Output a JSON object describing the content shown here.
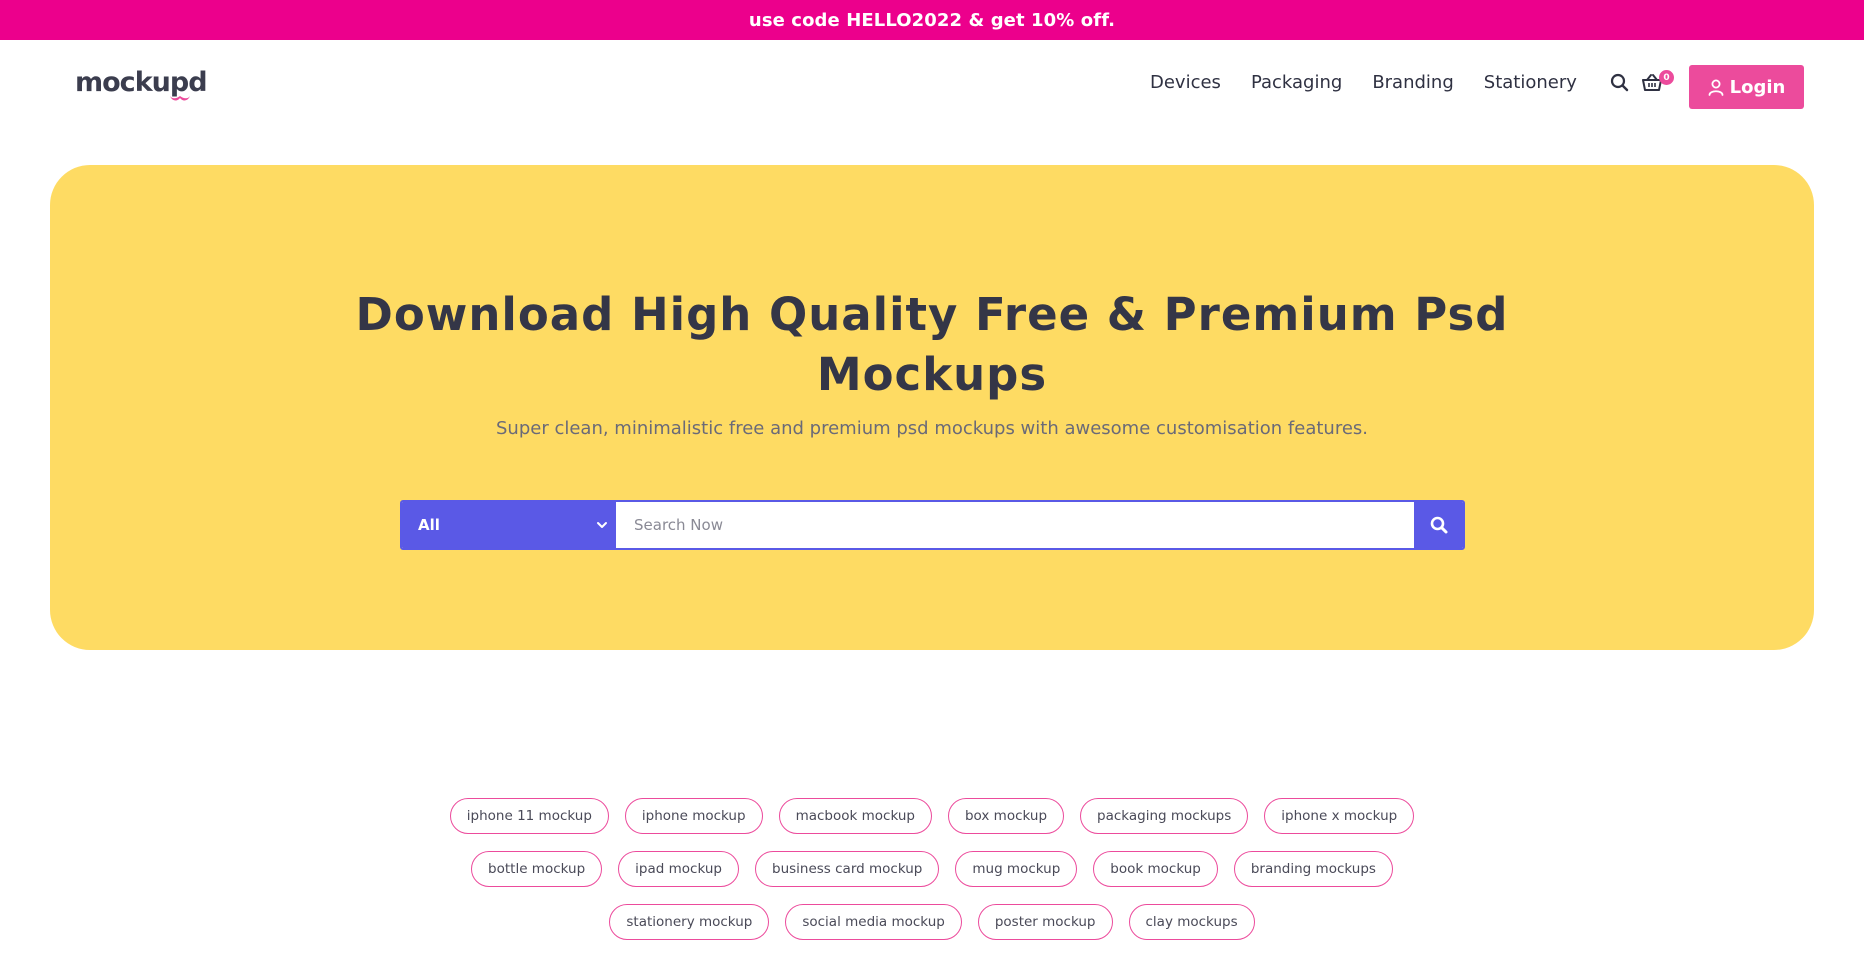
{
  "promo": {
    "text": "use code HELLO2022 & get 10% off."
  },
  "brand": {
    "logo_text": "mockupd"
  },
  "nav": {
    "items": [
      "Devices",
      "Packaging",
      "Branding",
      "Stationery"
    ],
    "search_icon": "search-icon",
    "cart_icon": "shopping-basket-icon",
    "cart_count": "0",
    "login_label": "Login",
    "login_icon": "user-icon"
  },
  "hero": {
    "title_line1": "Download High Quality Free & Premium Psd",
    "title_line2": "Mockups",
    "subtitle": "Super clean, minimalistic free and premium psd mockups with awesome customisation features.",
    "search": {
      "category_selected": "All",
      "placeholder": "Search Now",
      "value": ""
    }
  },
  "tags": [
    [
      "iphone 11 mockup",
      "iphone mockup",
      "macbook mockup",
      "box mockup",
      "packaging mockups",
      "iphone x mockup"
    ],
    [
      "bottle mockup",
      "ipad mockup",
      "business card mockup",
      "mug mockup",
      "book mockup",
      "branding mockups"
    ],
    [
      "stationery mockup",
      "social media mockup",
      "poster mockup",
      "clay mockups"
    ]
  ],
  "colors": {
    "promo_bg": "#ec008c",
    "accent_pink": "#ec4b9c",
    "hero_bg": "#fedb63",
    "search_blue": "#5a59e6",
    "text_dark": "#2f3142"
  }
}
